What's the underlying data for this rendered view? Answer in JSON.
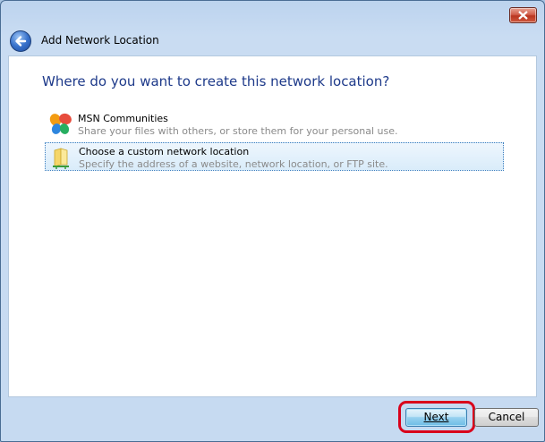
{
  "window": {
    "title": "Add Network Location",
    "close_icon": "close-icon",
    "back_icon": "back-arrow-icon"
  },
  "content": {
    "heading": "Where do you want to create this network location?",
    "options": [
      {
        "title": "MSN Communities",
        "description": "Share your files with others, or store them for your personal use.",
        "icon": "msn-butterfly-icon",
        "selected": false
      },
      {
        "title": "Choose a custom network location",
        "description": "Specify the address of a website, network location, or FTP site.",
        "icon": "folder-network-icon",
        "selected": true
      }
    ]
  },
  "footer": {
    "next_label": "Next",
    "cancel_label": "Cancel"
  },
  "colors": {
    "heading": "#1e3a8a",
    "highlight": "#d9001b",
    "selection": "#d9ecfa"
  }
}
